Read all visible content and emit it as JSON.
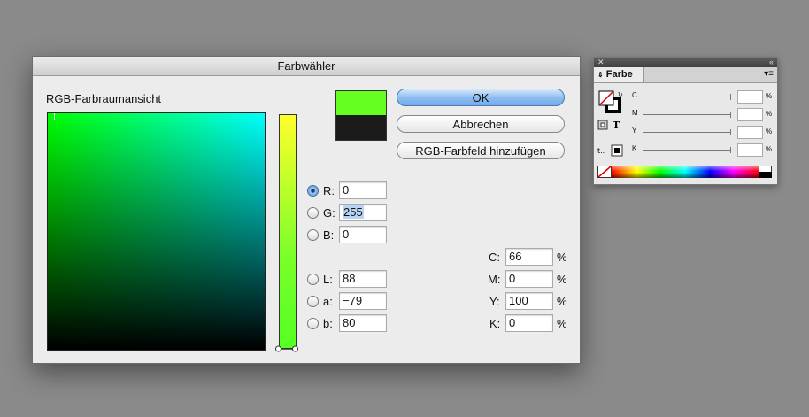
{
  "dialog": {
    "title": "Farbwähler",
    "section_label": "RGB-Farbraumansicht",
    "buttons": {
      "ok": "OK",
      "cancel": "Abbrechen",
      "add_swatch": "RGB-Farbfeld hinzufügen"
    },
    "swatches": {
      "new_color": "#66ff22",
      "original_color": "#1b1b1b"
    },
    "rgb": [
      {
        "label": "R:",
        "value": "0",
        "selected": true
      },
      {
        "label": "G:",
        "value": "255",
        "selected": false
      },
      {
        "label": "B:",
        "value": "0",
        "selected": false
      }
    ],
    "lab": [
      {
        "label": "L:",
        "value": "88",
        "selected": false
      },
      {
        "label": "a:",
        "value": "−79",
        "selected": false
      },
      {
        "label": "b:",
        "value": "80",
        "selected": false
      }
    ],
    "cmyk": [
      {
        "label": "C:",
        "value": "66",
        "unit": "%"
      },
      {
        "label": "M:",
        "value": "0",
        "unit": "%"
      },
      {
        "label": "Y:",
        "value": "100",
        "unit": "%"
      },
      {
        "label": "K:",
        "value": "0",
        "unit": "%"
      }
    ]
  },
  "panel": {
    "tab_label": "Farbe",
    "rows": [
      {
        "label": "C",
        "unit": "%"
      },
      {
        "label": "M",
        "unit": "%"
      },
      {
        "label": "Y",
        "unit": "%"
      },
      {
        "label": "K",
        "unit": "%"
      }
    ]
  }
}
